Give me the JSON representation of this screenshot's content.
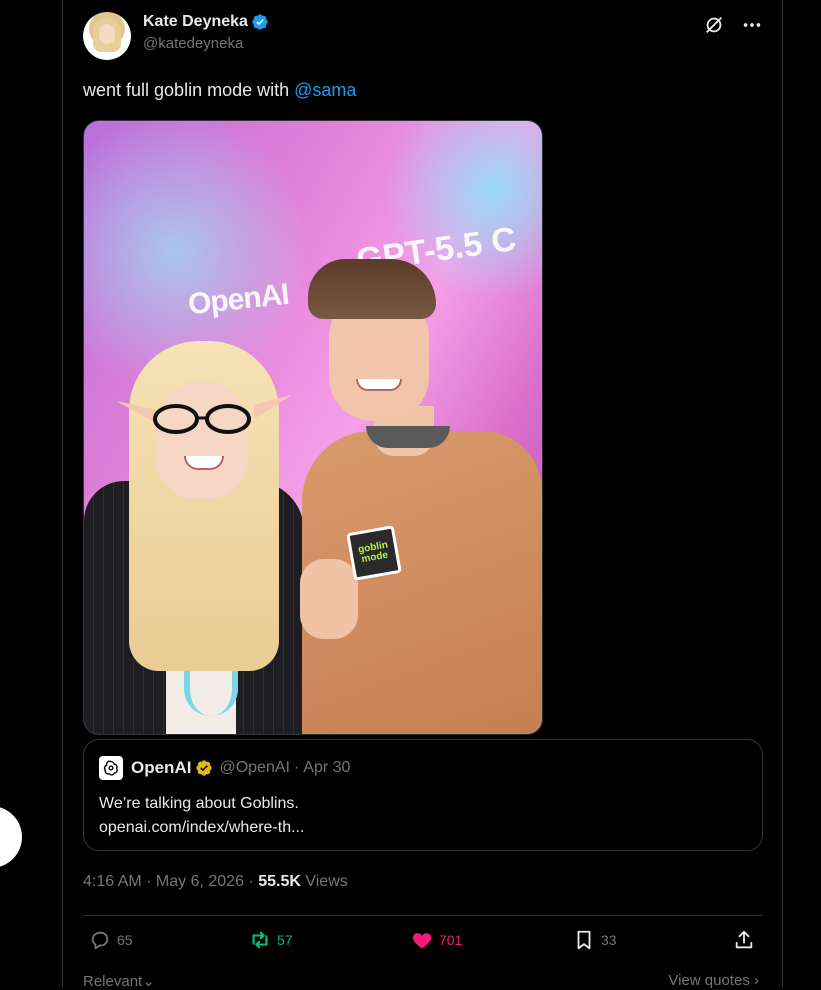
{
  "tweet": {
    "author": {
      "display_name": "Kate Deyneka",
      "handle": "@katedeyneka",
      "verified": true
    },
    "text_before": "went full goblin mode with ",
    "mention": "@sama",
    "media": {
      "screen_text_left": "OpenAI",
      "screen_text_right": "GPT-5.5 C",
      "sticker_text": "goblin mode"
    },
    "quote": {
      "name": "OpenAI",
      "handle": "@OpenAI",
      "separator": "·",
      "date": "Apr 30",
      "text": "We’re talking about Goblins.",
      "link": "openai.com/index/where-th..."
    },
    "timestamp": "4:16 AM · May 6, 2026 · ",
    "views_count": "55.5K",
    "views_label": " Views",
    "actions": {
      "reply_count": "65",
      "repost_count": "57",
      "like_count": "701",
      "bookmark_count": "33"
    },
    "sort_label": "Relevant",
    "view_quotes_label": "View quotes"
  },
  "colors": {
    "background": "#000000",
    "text": "#e7e9ea",
    "muted": "#71767b",
    "accent_blue": "#1d9bf0",
    "repost_green": "#00ba7c",
    "like_pink": "#f91880",
    "gold_verified": "#e2b719"
  },
  "icons": [
    "verified-badge-icon",
    "grok-icon",
    "more-icon",
    "reply-icon",
    "repost-icon",
    "like-icon",
    "bookmark-icon",
    "share-icon",
    "chevron-down-icon",
    "chevron-right-icon",
    "openai-logo-icon"
  ]
}
